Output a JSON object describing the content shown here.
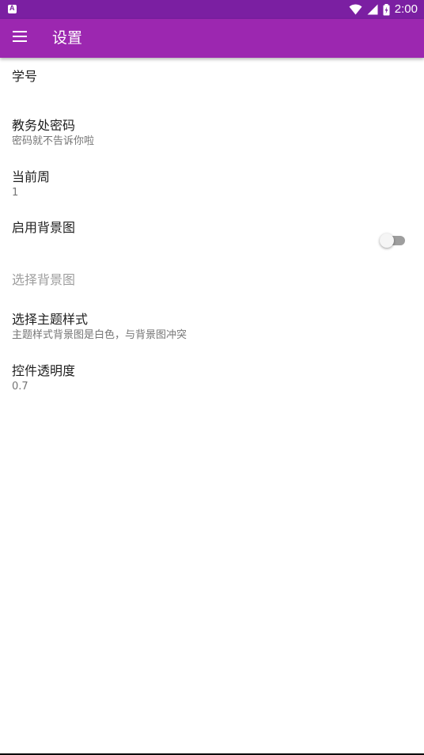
{
  "status_bar": {
    "time": "2:00",
    "icons": [
      "notification-a-icon",
      "wifi-icon",
      "signal-icon",
      "battery-icon"
    ],
    "color": "#7b1fa2"
  },
  "app_bar": {
    "title": "设置",
    "color": "#9c27b0",
    "menu_icon": "menu-icon"
  },
  "preferences": [
    {
      "id": "student-id",
      "title": "学号",
      "summary": ""
    },
    {
      "id": "academic-password",
      "title": "教务处密码",
      "summary": "密码就不告诉你啦"
    },
    {
      "id": "current-week",
      "title": "当前周",
      "summary": "1"
    },
    {
      "id": "enable-background",
      "title": "启用背景图",
      "summary": "",
      "switch_on": false
    },
    {
      "id": "choose-background",
      "title": "选择背景图",
      "summary": "",
      "enabled": false
    },
    {
      "id": "choose-theme",
      "title": "选择主题样式",
      "summary": "主题样式背景图是白色，与背景图冲突"
    },
    {
      "id": "widget-opacity",
      "title": "控件透明度",
      "summary": "0.7"
    }
  ]
}
